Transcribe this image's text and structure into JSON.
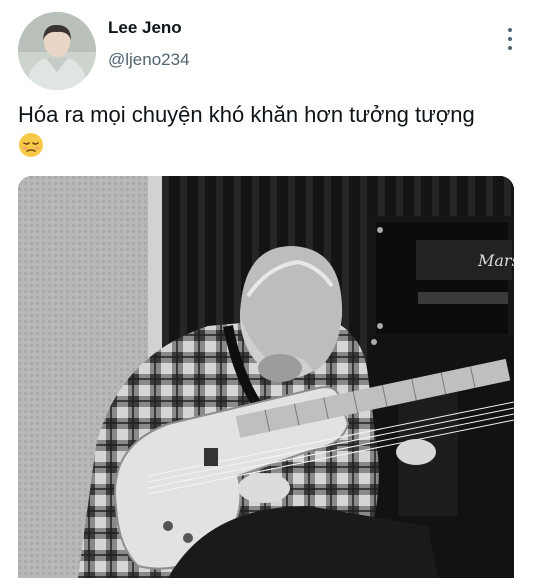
{
  "user": {
    "display_name": "Lee Jeno",
    "handle": "@ljeno234",
    "avatar_icon": "avatar-photo"
  },
  "tweet": {
    "text": "Hóa ra mọi chuyện khó khăn hơn tưởng tượng",
    "emoji": "pensive-face-emoji"
  },
  "menu_icon": "more-options-icon",
  "amp_brand": "Marshall",
  "colors": {
    "name": "#0f1419",
    "handle": "#536471",
    "emoji_face": "#f7c948"
  }
}
